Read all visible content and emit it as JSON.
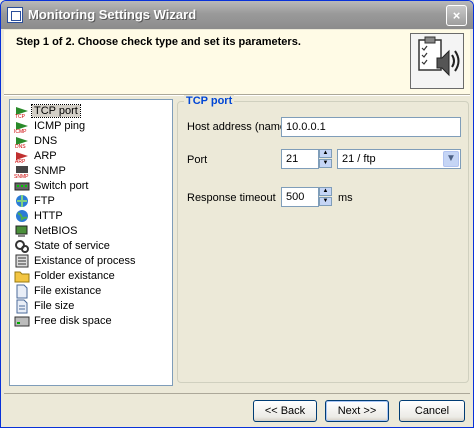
{
  "window": {
    "title": "Monitoring Settings Wizard",
    "close_label": "×"
  },
  "header": {
    "step_text": "Step 1 of 2. Choose check type and set its parameters."
  },
  "check_types": [
    {
      "label": "TCP port",
      "icon": "tcp-icon",
      "selected": true
    },
    {
      "label": "ICMP ping",
      "icon": "icmp-icon"
    },
    {
      "label": "DNS",
      "icon": "dns-icon"
    },
    {
      "label": "ARP",
      "icon": "arp-icon"
    },
    {
      "label": "SNMP",
      "icon": "snmp-icon"
    },
    {
      "label": "Switch port",
      "icon": "switch-port-icon"
    },
    {
      "label": "FTP",
      "icon": "ftp-icon"
    },
    {
      "label": "HTTP",
      "icon": "http-icon"
    },
    {
      "label": "NetBIOS",
      "icon": "netbios-icon"
    },
    {
      "label": "State of service",
      "icon": "service-icon"
    },
    {
      "label": "Existance of process",
      "icon": "process-icon"
    },
    {
      "label": "Folder existance",
      "icon": "folder-icon"
    },
    {
      "label": "File existance",
      "icon": "file-icon"
    },
    {
      "label": "File size",
      "icon": "file-size-icon"
    },
    {
      "label": "Free disk space",
      "icon": "disk-icon"
    }
  ],
  "settings": {
    "group_title": "TCP port",
    "host_label": "Host address (name)",
    "host_value": "10.0.0.1",
    "port_label": "Port",
    "port_value": "21",
    "port_service": "21 / ftp",
    "timeout_label": "Response timeout",
    "timeout_value": "500",
    "timeout_unit": "ms"
  },
  "buttons": {
    "back": "<< Back",
    "next": "Next >>",
    "cancel": "Cancel"
  }
}
